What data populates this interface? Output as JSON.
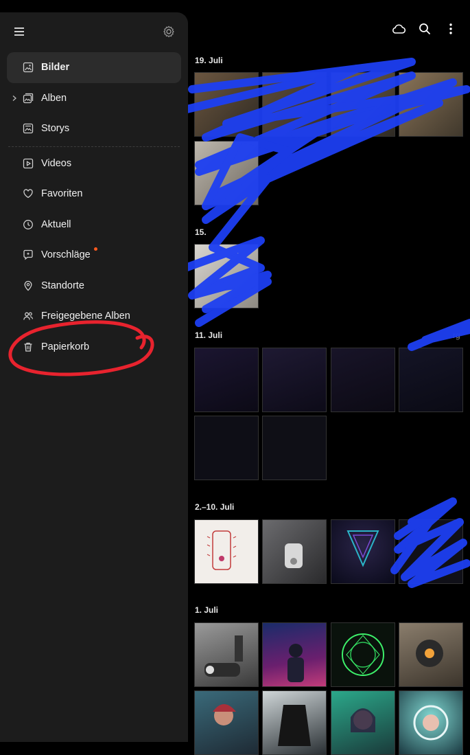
{
  "colors": {
    "background": "#000000",
    "drawer": "#1c1c1c",
    "active_item": "#2c2c2c",
    "text": "#f0f0f0",
    "notification_dot": "#ff5a1f",
    "scribble_blue": "#1d3ff2",
    "circle_red": "#e8232e"
  },
  "topbar": {
    "icons": [
      "cloud-icon",
      "search-icon",
      "more-vert-icon"
    ]
  },
  "drawer": {
    "menu_icon": "menu-icon",
    "settings_icon": "gear-icon",
    "items": [
      {
        "label": "Bilder",
        "icon": "image-icon",
        "active": true
      },
      {
        "label": "Alben",
        "icon": "albums-icon",
        "expandable": true
      },
      {
        "label": "Storys",
        "icon": "stories-icon"
      },
      {
        "label": "Videos",
        "icon": "video-icon"
      },
      {
        "label": "Favoriten",
        "icon": "heart-icon"
      },
      {
        "label": "Aktuell",
        "icon": "clock-icon"
      },
      {
        "label": "Vorschläge",
        "icon": "suggestions-icon",
        "badge": true
      },
      {
        "label": "Standorte",
        "icon": "location-icon"
      },
      {
        "label": "Freigegebene Alben",
        "icon": "shared-albums-icon"
      },
      {
        "label": "Papierkorb",
        "icon": "trash-icon"
      }
    ]
  },
  "gallery": {
    "sections": [
      {
        "date": "19. Juli"
      },
      {
        "date": "15."
      },
      {
        "date": "11. Juli"
      },
      {
        "date": "2.–10. Juli"
      },
      {
        "date": "1. Juli"
      }
    ],
    "partial_label": "rg"
  }
}
